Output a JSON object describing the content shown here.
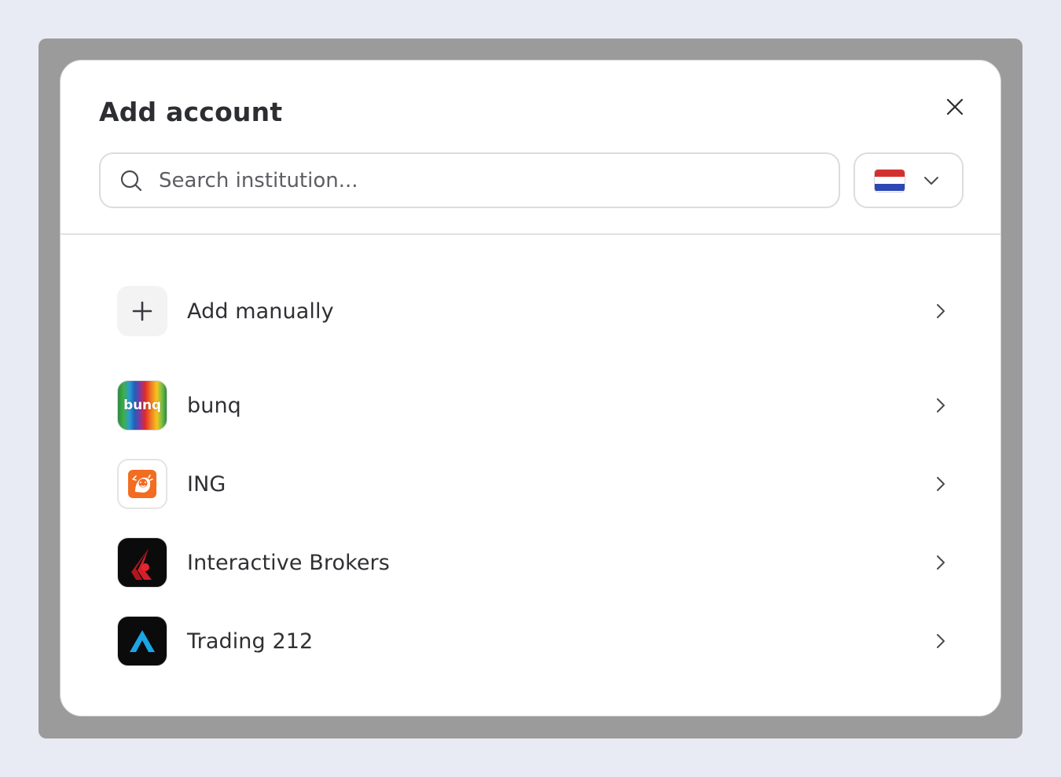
{
  "modal": {
    "title": "Add account"
  },
  "search": {
    "placeholder": "Search institution...",
    "value": ""
  },
  "country_select": {
    "selected": "Netherlands",
    "flag_colors": [
      "#d42f2f",
      "#ffffff",
      "#2b48b4"
    ]
  },
  "institutions": [
    {
      "label": "Add manually",
      "icon": "plus-icon"
    },
    {
      "label": "bunq",
      "icon": "bunq-logo",
      "logo_text": "bunq"
    },
    {
      "label": "ING",
      "icon": "ing-lion-logo",
      "accent": "#f26d21"
    },
    {
      "label": "Interactive Brokers",
      "icon": "interactive-brokers-logo",
      "accent": "#d0202a"
    },
    {
      "label": "Trading 212",
      "icon": "trading212-logo",
      "accent": "#1aa5e6"
    }
  ]
}
